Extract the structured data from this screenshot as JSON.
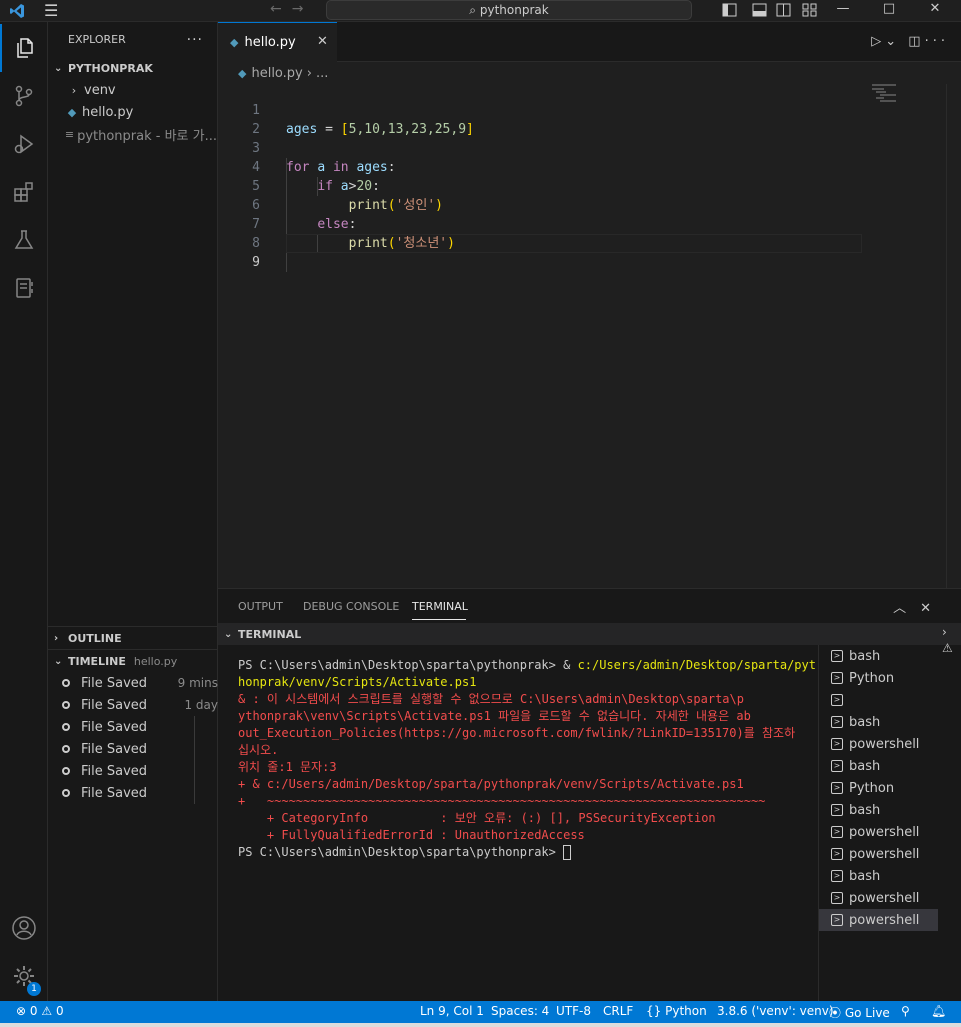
{
  "titlebar": {
    "search": "pythonprak",
    "menu_icon": "hamburger-icon",
    "minimize": "—",
    "maximize": "□",
    "close": "✕"
  },
  "sidebar": {
    "title": "EXPLORER",
    "more": "···",
    "folder": "PYTHONPRAK",
    "items": [
      {
        "label": "venv",
        "icon": "chevron-right-icon"
      },
      {
        "label": "hello.py",
        "icon": "python-icon"
      },
      {
        "label": "pythonprak - 바로 가...",
        "icon": "shortcut-file-icon"
      }
    ],
    "outline": "OUTLINE",
    "timeline": {
      "title": "TIMELINE",
      "file": "hello.py",
      "entries": [
        {
          "label": "File Saved",
          "time": "9 mins"
        },
        {
          "label": "File Saved",
          "time": "1 day"
        },
        {
          "label": "File Saved",
          "time": ""
        },
        {
          "label": "File Saved",
          "time": ""
        },
        {
          "label": "File Saved",
          "time": ""
        },
        {
          "label": "File Saved",
          "time": ""
        }
      ]
    }
  },
  "editor": {
    "tab": "hello.py",
    "breadcrumb_file": "hello.py",
    "breadcrumb_more": "...",
    "line_numbers": [
      "1",
      "2",
      "3",
      "4",
      "5",
      "6",
      "7",
      "8",
      "9"
    ],
    "code": {
      "l1_var": "ages",
      "l1_eq": " = ",
      "l1_open": "[",
      "l1_vals": "5,10,13,23,25,9",
      "l1_close": "]",
      "l3_for": "for",
      "l3_a": "a",
      "l3_in": "in",
      "l3_ages": "ages",
      "l3_colon": ":",
      "l4_if": "if",
      "l4_a": "a",
      "l4_gt": ">",
      "l4_num": "20",
      "l4_colon": ":",
      "l5_fn": "print",
      "l5_open": "(",
      "l5_str": "'성인'",
      "l5_close": ")",
      "l6_else": "else",
      "l6_colon": ":",
      "l7_fn": "print",
      "l7_open": "(",
      "l7_str": "'청소년'",
      "l7_close": ")"
    }
  },
  "panel": {
    "tabs": [
      "OUTPUT",
      "DEBUG CONSOLE",
      "TERMINAL"
    ],
    "active_tab": "TERMINAL",
    "section": "TERMINAL",
    "terminal_lines": [
      {
        "kind": "ps",
        "prompt": "PS C:\\Users\\admin\\Desktop\\sparta\\pythonprak> & ",
        "cmd": "c:/Users/admin/Desktop/sparta/pyt"
      },
      {
        "kind": "cmd",
        "text": "honprak/venv/Scripts/Activate.ps1"
      },
      {
        "kind": "err",
        "text": "& : 이 시스템에서 스크립트를 실행할 수 없으므로 C:\\Users\\admin\\Desktop\\sparta\\p"
      },
      {
        "kind": "err",
        "text": "ythonprak\\venv\\Scripts\\Activate.ps1 파일을 로드할 수 없습니다. 자세한 내용은 ab"
      },
      {
        "kind": "err",
        "text": "out_Execution_Policies(https://go.microsoft.com/fwlink/?LinkID=135170)를 참조하"
      },
      {
        "kind": "err",
        "text": "십시오."
      },
      {
        "kind": "err",
        "text": "위치 줄:1 문자:3"
      },
      {
        "kind": "err",
        "text": "+ & c:/Users/admin/Desktop/sparta/pythonprak/venv/Scripts/Activate.ps1"
      },
      {
        "kind": "err",
        "text": "+   ~~~~~~~~~~~~~~~~~~~~~~~~~~~~~~~~~~~~~~~~~~~~~~~~~~~~~~~~~~~~~~~~~~~~~"
      },
      {
        "kind": "err",
        "text": "    + CategoryInfo          : 보안 오류: (:) [], PSSecurityException"
      },
      {
        "kind": "err",
        "text": "    + FullyQualifiedErrorId : UnauthorizedAccess"
      },
      {
        "kind": "prompt",
        "text": "PS C:\\Users\\admin\\Desktop\\sparta\\pythonprak> "
      }
    ],
    "terminals": [
      {
        "label": "bash",
        "selected": false
      },
      {
        "label": "Python",
        "selected": false
      },
      {
        "label": "",
        "selected": false
      },
      {
        "label": "bash",
        "selected": false
      },
      {
        "label": "powershell",
        "selected": false
      },
      {
        "label": "bash",
        "selected": false
      },
      {
        "label": "Python",
        "selected": false
      },
      {
        "label": "bash",
        "selected": false
      },
      {
        "label": "powershell",
        "selected": false
      },
      {
        "label": "powershell",
        "selected": false
      },
      {
        "label": "bash",
        "selected": false
      },
      {
        "label": "powershell",
        "selected": false
      },
      {
        "label": "powershell",
        "selected": true
      }
    ]
  },
  "activity": {
    "badge": "1"
  },
  "statusbar": {
    "errors": "0",
    "warnings": "0",
    "position": "Ln 9, Col 1",
    "spaces": "Spaces: 4",
    "encoding": "UTF-8",
    "eol": "CRLF",
    "language": "Python",
    "interpreter": "3.8.6 ('venv': venv)",
    "golive": "Go Live"
  },
  "colors": {
    "accent": "#0078d4",
    "error": "#f14c4c",
    "command": "#e5e510"
  }
}
